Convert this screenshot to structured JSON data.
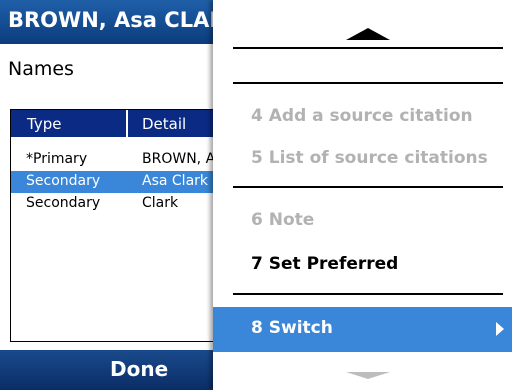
{
  "screen": {
    "title": "BROWN, Asa CLARK",
    "section_label": "Names",
    "columns": [
      "Type",
      "Detail"
    ],
    "rows": [
      {
        "type": "*Primary",
        "detail": "BROWN, Asa CLARK"
      },
      {
        "type": "Secondary",
        "detail": "Asa Clark"
      },
      {
        "type": "Secondary",
        "detail": "Clark"
      }
    ],
    "selected_row": 1,
    "softkey_left": "Done"
  },
  "menu": {
    "items": [
      {
        "label": "4 Add a source citation",
        "enabled": false
      },
      {
        "label": "5 List of source citations",
        "enabled": false
      },
      {
        "label": "6 Note",
        "enabled": false
      },
      {
        "label": "7 Set Preferred",
        "enabled": true
      },
      {
        "label": "8 Switch",
        "enabled": true,
        "highlighted": true,
        "has_submenu": true
      }
    ],
    "scroll_up": "up-arrow-icon",
    "scroll_down": "down-arrow-icon"
  },
  "colors": {
    "title_bar": "#0b3d7d",
    "header_row": "#0a2a84",
    "selection": "#3a86d8",
    "disabled_text": "#b2b2b2"
  }
}
